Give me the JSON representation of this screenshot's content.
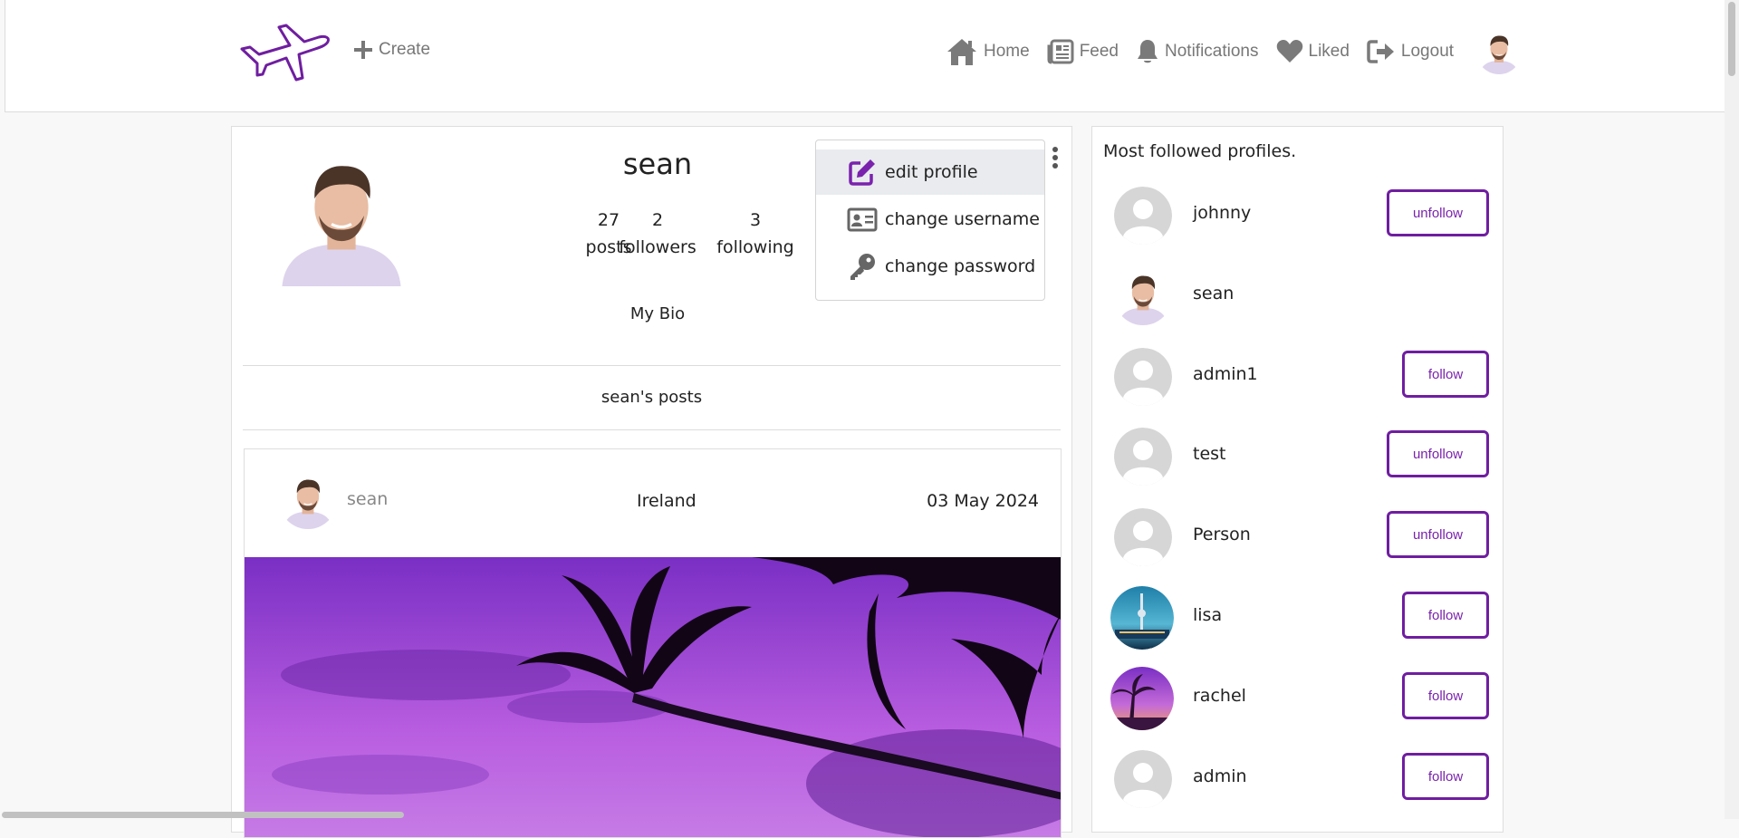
{
  "colors": {
    "brand": "#6f1ea0",
    "nav_text": "#777777"
  },
  "navbar": {
    "create_label": "Create",
    "items": [
      {
        "label": "Home",
        "icon": "home-icon"
      },
      {
        "label": "Feed",
        "icon": "newspaper-icon"
      },
      {
        "label": "Notifications",
        "icon": "bell-icon"
      },
      {
        "label": "Liked",
        "icon": "heart-icon"
      },
      {
        "label": "Logout",
        "icon": "logout-icon"
      }
    ]
  },
  "profile": {
    "username": "sean",
    "stats": [
      {
        "value": "27",
        "label": "posts"
      },
      {
        "value": "2",
        "label": "followers"
      },
      {
        "value": "3",
        "label": "following"
      }
    ],
    "bio": "My Bio",
    "posts_heading": "sean's posts"
  },
  "menu": {
    "items": [
      {
        "label": "edit profile",
        "icon": "edit-icon"
      },
      {
        "label": "change username",
        "icon": "id-card-icon"
      },
      {
        "label": "change password",
        "icon": "key-icon"
      }
    ]
  },
  "post": {
    "username": "sean",
    "location": "Ireland",
    "date": "03 May 2024"
  },
  "sidebar": {
    "title": "Most followed profiles.",
    "profiles": [
      {
        "name": "johnny",
        "button": "unfollow",
        "avatar": "default"
      },
      {
        "name": "sean",
        "button": "",
        "avatar": "sean"
      },
      {
        "name": "admin1",
        "button": "follow",
        "avatar": "default"
      },
      {
        "name": "test",
        "button": "unfollow",
        "avatar": "default"
      },
      {
        "name": "Person",
        "button": "unfollow",
        "avatar": "default"
      },
      {
        "name": "lisa",
        "button": "follow",
        "avatar": "city"
      },
      {
        "name": "rachel",
        "button": "follow",
        "avatar": "sunset"
      },
      {
        "name": "admin",
        "button": "follow",
        "avatar": "default"
      }
    ]
  }
}
